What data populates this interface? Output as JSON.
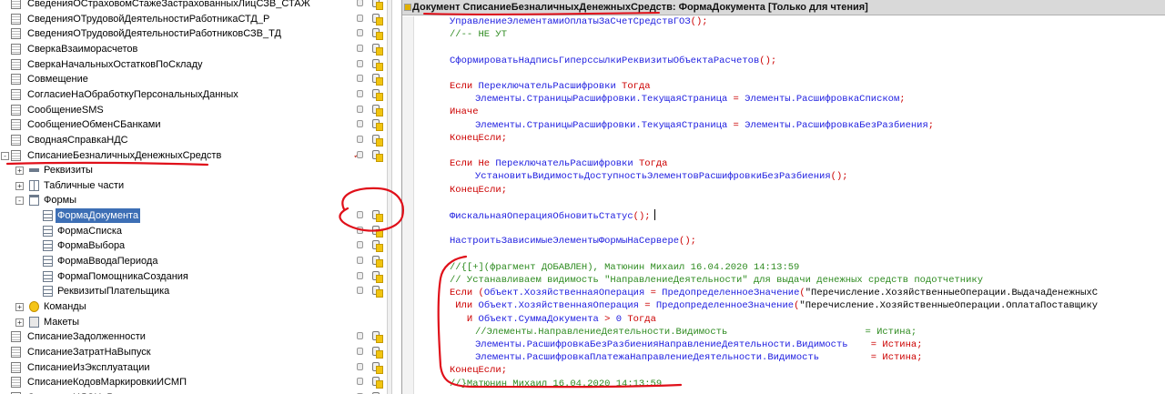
{
  "tree": {
    "items": [
      {
        "label": "СведенияОСтраховомСтажеЗастрахованныхЛицСЗВ_СТАЖ",
        "level": 0,
        "icon": "document-icon",
        "expand": "",
        "state": "lock-group"
      },
      {
        "label": "СведенияОТрудовойДеятельностиРаботникаСТД_Р",
        "level": 0,
        "icon": "document-icon",
        "expand": "",
        "state": "lock-group"
      },
      {
        "label": "СведенияОТрудовойДеятельностиРаботниковСЗВ_ТД",
        "level": 0,
        "icon": "document-icon",
        "expand": "",
        "state": "lock-group"
      },
      {
        "label": "СверкаВзаиморасчетов",
        "level": 0,
        "icon": "document-icon",
        "expand": "",
        "state": "lock-group"
      },
      {
        "label": "СверкаНачальныхОстатковПоСкладу",
        "level": 0,
        "icon": "document-icon",
        "expand": "",
        "state": "lock-group"
      },
      {
        "label": "Совмещение",
        "level": 0,
        "icon": "document-icon",
        "expand": "",
        "state": "lock-group"
      },
      {
        "label": "СогласиеНаОбработкуПерсональныхДанных",
        "level": 0,
        "icon": "document-icon",
        "expand": "",
        "state": "lock-group"
      },
      {
        "label": "СообщениеSMS",
        "level": 0,
        "icon": "document-icon",
        "expand": "",
        "state": "lock-group"
      },
      {
        "label": "СообщениеОбменСБанками",
        "level": 0,
        "icon": "document-icon",
        "expand": "",
        "state": "lock-group"
      },
      {
        "label": "СводнаяСправкаНДС",
        "level": 0,
        "icon": "document-icon",
        "expand": "",
        "state": "lock-group"
      },
      {
        "label": "СписаниеБезналичныхДенежныхСредств",
        "level": 0,
        "icon": "document-icon",
        "expand": "−",
        "state": "check-lock"
      },
      {
        "label": "Реквизиты",
        "level": 1,
        "icon": "attributes-icon",
        "expand": "+",
        "state": ""
      },
      {
        "label": "Табличные части",
        "level": 1,
        "icon": "table-icon",
        "expand": "+",
        "state": ""
      },
      {
        "label": "Формы",
        "level": 1,
        "icon": "forms-icon",
        "expand": "−",
        "state": ""
      },
      {
        "label": "ФормаДокумента",
        "level": 2,
        "icon": "form-icon",
        "expand": "",
        "state": "lock-group",
        "selected": true
      },
      {
        "label": "ФормаСписка",
        "level": 2,
        "icon": "form-icon",
        "expand": "",
        "state": "lock-group"
      },
      {
        "label": "ФормаВыбора",
        "level": 2,
        "icon": "form-icon",
        "expand": "",
        "state": "lock-group"
      },
      {
        "label": "ФормаВводаПериода",
        "level": 2,
        "icon": "form-icon",
        "expand": "",
        "state": "lock-group"
      },
      {
        "label": "ФормаПомощникаСоздания",
        "level": 2,
        "icon": "form-icon",
        "expand": "",
        "state": "lock-group"
      },
      {
        "label": "РеквизитыПлательщика",
        "level": 2,
        "icon": "form-icon",
        "expand": "",
        "state": "lock-group"
      },
      {
        "label": "Команды",
        "level": 1,
        "icon": "commands-icon",
        "expand": "+",
        "state": ""
      },
      {
        "label": "Макеты",
        "level": 1,
        "icon": "layouts-icon",
        "expand": "+",
        "state": ""
      },
      {
        "label": "СписаниеЗадолженности",
        "level": 0,
        "icon": "document-icon",
        "expand": "",
        "state": "lock-group"
      },
      {
        "label": "СписаниеЗатратНаВыпуск",
        "level": 0,
        "icon": "document-icon",
        "expand": "",
        "state": "lock-group"
      },
      {
        "label": "СписаниеИзЭксплуатации",
        "level": 0,
        "icon": "document-icon",
        "expand": "",
        "state": "lock-group"
      },
      {
        "label": "СписаниеКодовМаркировкиИСМП",
        "level": 0,
        "icon": "document-icon",
        "expand": "",
        "state": "lock-group"
      },
      {
        "label": "СписаниеНДСНаРасходы",
        "level": 0,
        "icon": "document-icon",
        "expand": "",
        "state": "lock-group"
      }
    ]
  },
  "editor": {
    "title": "Документ СписаниеБезналичныхДенежныхСредств: ФормаДокумента [Только для чтения]",
    "lines": [
      {
        "indent": 0,
        "parts": [
          [
            "pl",
            "УправлениеЭлементамиОплатыЗаСчетСредствГОЗ"
          ],
          [
            "op",
            "();"
          ]
        ]
      },
      {
        "indent": 0,
        "parts": [
          [
            "cm",
            "//-- НЕ УТ"
          ]
        ]
      },
      {
        "indent": 0,
        "parts": []
      },
      {
        "indent": 0,
        "parts": [
          [
            "pl",
            "СформироватьНадписьГиперссылкиРеквизитыОбъектаРасчетов"
          ],
          [
            "op",
            "();"
          ]
        ]
      },
      {
        "indent": 0,
        "parts": []
      },
      {
        "indent": 0,
        "parts": [
          [
            "kw",
            "Если "
          ],
          [
            "pl",
            "ПереключательРасшифровки "
          ],
          [
            "kw",
            "Тогда"
          ]
        ]
      },
      {
        "indent": 1,
        "parts": [
          [
            "pl",
            "Элементы.СтраницыРасшифровки.ТекущаяСтраница "
          ],
          [
            "op",
            "= "
          ],
          [
            "pl",
            "Элементы.РасшифровкаСписком"
          ],
          [
            "op",
            ";"
          ]
        ]
      },
      {
        "indent": 0,
        "parts": [
          [
            "kw",
            "Иначе"
          ]
        ]
      },
      {
        "indent": 1,
        "parts": [
          [
            "pl",
            "Элементы.СтраницыРасшифровки.ТекущаяСтраница "
          ],
          [
            "op",
            "= "
          ],
          [
            "pl",
            "Элементы.РасшифровкаБезРазбиения"
          ],
          [
            "op",
            ";"
          ]
        ]
      },
      {
        "indent": 0,
        "parts": [
          [
            "kw",
            "КонецЕсли"
          ],
          [
            "op",
            ";"
          ]
        ]
      },
      {
        "indent": 0,
        "parts": []
      },
      {
        "indent": 0,
        "parts": [
          [
            "kw",
            "Если Не "
          ],
          [
            "pl",
            "ПереключательРасшифровки "
          ],
          [
            "kw",
            "Тогда"
          ]
        ]
      },
      {
        "indent": 1,
        "parts": [
          [
            "pl",
            "УстановитьВидимостьДоступностьЭлементовРасшифровкиБезРазбиения"
          ],
          [
            "op",
            "();"
          ]
        ]
      },
      {
        "indent": 0,
        "parts": [
          [
            "kw",
            "КонецЕсли"
          ],
          [
            "op",
            ";"
          ]
        ]
      },
      {
        "indent": 0,
        "parts": []
      },
      {
        "indent": 0,
        "parts": [
          [
            "pl",
            "ФискальнаяОперацияОбновитьСтатус"
          ],
          [
            "op",
            "();"
          ],
          [
            "caret",
            ""
          ]
        ]
      },
      {
        "indent": 0,
        "parts": []
      },
      {
        "indent": 0,
        "parts": [
          [
            "pl",
            "НастроитьЗависимыеЭлементыФормыНаСервере"
          ],
          [
            "op",
            "();"
          ]
        ]
      },
      {
        "indent": 0,
        "parts": []
      },
      {
        "indent": 0,
        "parts": [
          [
            "cm",
            "//{[+](фрагмент ДОБАВЛЕН), Матюнин Михаил 16.04.2020 14:13:59"
          ]
        ]
      },
      {
        "indent": 0,
        "parts": [
          [
            "cm",
            "// Устанавливаем видимость \"НаправлениеДеятельности\" для выдачи денежных средств подотчетнику"
          ]
        ]
      },
      {
        "indent": 0,
        "parts": [
          [
            "kw",
            "Если "
          ],
          [
            "op",
            "("
          ],
          [
            "pl",
            "Объект.ХозяйственнаяОперация "
          ],
          [
            "op",
            "= "
          ],
          [
            "pl",
            "ПредопределенноеЗначение"
          ],
          [
            "op",
            "("
          ],
          [
            "str",
            "\"Перечисление.ХозяйственныеОперации.ВыдачаДенежныхС"
          ]
        ]
      },
      {
        "indent": 0,
        "parts": [
          [
            "kw",
            " Или "
          ],
          [
            "pl",
            "Объект.ХозяйственнаяОперация "
          ],
          [
            "op",
            "= "
          ],
          [
            "pl",
            "ПредопределенноеЗначение"
          ],
          [
            "op",
            "("
          ],
          [
            "str",
            "\"Перечисление.ХозяйственныеОперации.ОплатаПоставщику"
          ]
        ]
      },
      {
        "indent": 0,
        "parts": [
          [
            "kw",
            "   И "
          ],
          [
            "pl",
            "Объект.СуммаДокумента "
          ],
          [
            "op",
            "> "
          ],
          [
            "pl",
            "0 "
          ],
          [
            "kw",
            "Тогда"
          ]
        ]
      },
      {
        "indent": 1,
        "parts": [
          [
            "cm",
            "//Элементы.НаправлениеДеятельности.Видимость                        = Истина;"
          ]
        ]
      },
      {
        "indent": 1,
        "parts": [
          [
            "pl",
            "Элементы.РасшифровкаБезРазбиенияНаправлениеДеятельности.Видимость    "
          ],
          [
            "op",
            "= "
          ],
          [
            "kw",
            "Истина"
          ],
          [
            "op",
            ";"
          ]
        ]
      },
      {
        "indent": 1,
        "parts": [
          [
            "pl",
            "Элементы.РасшифровкаПлатежаНаправлениеДеятельности.Видимость         "
          ],
          [
            "op",
            "= "
          ],
          [
            "kw",
            "Истина"
          ],
          [
            "op",
            ";"
          ]
        ]
      },
      {
        "indent": 0,
        "parts": [
          [
            "kw",
            "КонецЕсли"
          ],
          [
            "op",
            ";"
          ]
        ]
      },
      {
        "indent": 0,
        "parts": [
          [
            "cm",
            "//}Матюнин Михаил 16.04.2020 14:13:59"
          ]
        ]
      }
    ]
  },
  "colors": {
    "annotation": "#e0101a",
    "keyword": "#cc0000",
    "identifier": "#2020e0",
    "comment": "#2e8b20",
    "selection": "#3d6fb5"
  }
}
